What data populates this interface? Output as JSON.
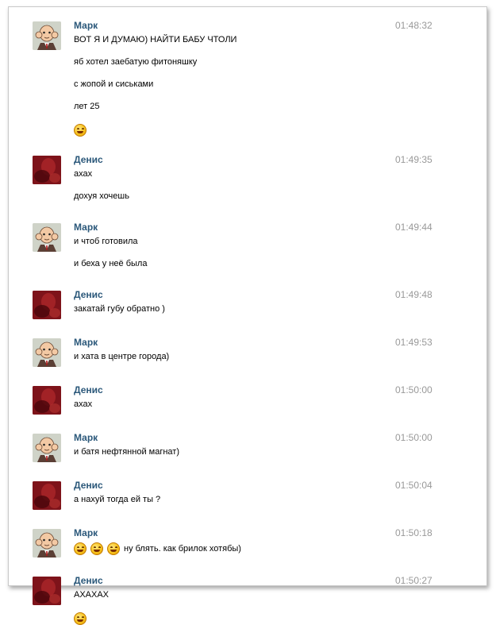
{
  "conversation": {
    "messages": [
      {
        "author": "Марк",
        "avatar": "mark-avatar",
        "time": "01:48:32",
        "lines": [
          {
            "text": "ВОТ Я И ДУМАЮ) НАЙТИ БАБУ ЧТОЛИ",
            "smiles": 0
          },
          {
            "text": "яб хотел заебатую фитоняшку",
            "smiles": 0
          },
          {
            "text": "с жопой и сиськами",
            "smiles": 0
          },
          {
            "text": "лет 25",
            "smiles": 0
          },
          {
            "text": "",
            "smiles": 1
          }
        ]
      },
      {
        "author": "Денис",
        "avatar": "denis-avatar",
        "time": "01:49:35",
        "lines": [
          {
            "text": "ахах",
            "smiles": 0
          },
          {
            "text": "дохуя хочешь",
            "smiles": 0
          }
        ]
      },
      {
        "author": "Марк",
        "avatar": "mark-avatar",
        "time": "01:49:44",
        "lines": [
          {
            "text": "и чтоб готовила",
            "smiles": 0
          },
          {
            "text": "и беха у неё была",
            "smiles": 0
          }
        ]
      },
      {
        "author": "Денис",
        "avatar": "denis-avatar",
        "time": "01:49:48",
        "lines": [
          {
            "text": "закатай губу обратно )",
            "smiles": 0
          }
        ]
      },
      {
        "author": "Марк",
        "avatar": "mark-avatar",
        "time": "01:49:53",
        "lines": [
          {
            "text": "и хата в центре города)",
            "smiles": 0
          }
        ]
      },
      {
        "author": "Денис",
        "avatar": "denis-avatar",
        "time": "01:50:00",
        "lines": [
          {
            "text": "ахах",
            "smiles": 0
          }
        ]
      },
      {
        "author": "Марк",
        "avatar": "mark-avatar",
        "time": "01:50:00",
        "lines": [
          {
            "text": "и батя нефтянной магнат)",
            "smiles": 0
          }
        ]
      },
      {
        "author": "Денис",
        "avatar": "denis-avatar",
        "time": "01:50:04",
        "lines": [
          {
            "text": "а нахуй тогда ей ты ?",
            "smiles": 0
          }
        ]
      },
      {
        "author": "Марк",
        "avatar": "mark-avatar",
        "time": "01:50:18",
        "lines": [
          {
            "text": "ну блять. как брилок хотябы)",
            "smiles": 3
          }
        ]
      },
      {
        "author": "Денис",
        "avatar": "denis-avatar",
        "time": "01:50:27",
        "lines": [
          {
            "text": "АХАХАХ",
            "smiles": 0
          },
          {
            "text": "",
            "smiles": 1
          }
        ]
      }
    ]
  }
}
